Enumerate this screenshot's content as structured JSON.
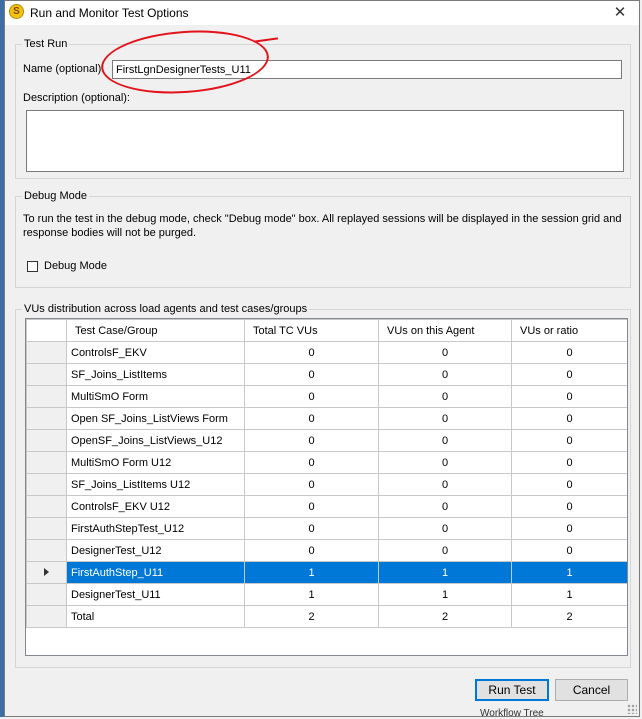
{
  "window": {
    "title": "Run and Monitor Test Options",
    "close_glyph": "✕",
    "icon_letter": "S"
  },
  "test_run": {
    "legend": "Test Run",
    "name_label": "Name (optional):",
    "name_value": "FirstLgnDesignerTests_U11",
    "description_label": "Description (optional):",
    "description_value": ""
  },
  "debug": {
    "legend": "Debug Mode",
    "info_line1": "To run the test in the debug mode, check \"Debug mode\" box. All replayed sessions will be displayed in the session grid and",
    "info_line2": "response bodies will not be purged.",
    "checkbox_label": "Debug Mode",
    "checked": false
  },
  "distribution": {
    "legend": "VUs distribution across load agents and test cases/groups",
    "columns": [
      "Test Case/Group",
      "Total TC VUs",
      "VUs on this Agent",
      "VUs or ratio"
    ],
    "rows": [
      {
        "name": "ControlsF_EKV",
        "total": "0",
        "agent": "0",
        "ratio": "0"
      },
      {
        "name": "SF_Joins_ListItems",
        "total": "0",
        "agent": "0",
        "ratio": "0"
      },
      {
        "name": "MultiSmO Form",
        "total": "0",
        "agent": "0",
        "ratio": "0"
      },
      {
        "name": "Open SF_Joins_ListViews Form",
        "total": "0",
        "agent": "0",
        "ratio": "0"
      },
      {
        "name": "OpenSF_Joins_ListViews_U12",
        "total": "0",
        "agent": "0",
        "ratio": "0"
      },
      {
        "name": "MultiSmO Form U12",
        "total": "0",
        "agent": "0",
        "ratio": "0"
      },
      {
        "name": "SF_Joins_ListItems  U12",
        "total": "0",
        "agent": "0",
        "ratio": "0"
      },
      {
        "name": "ControlsF_EKV  U12",
        "total": "0",
        "agent": "0",
        "ratio": "0"
      },
      {
        "name": "FirstAuthStepTest_U12",
        "total": "0",
        "agent": "0",
        "ratio": "0"
      },
      {
        "name": "DesignerTest_U12",
        "total": "0",
        "agent": "0",
        "ratio": "0"
      },
      {
        "name": "FirstAuthStep_U11",
        "total": "1",
        "agent": "1",
        "ratio": "1",
        "selected": true
      },
      {
        "name": "DesignerTest_U11",
        "total": "1",
        "agent": "1",
        "ratio": "1"
      },
      {
        "name": "Total",
        "total": "2",
        "agent": "2",
        "ratio": "2"
      }
    ]
  },
  "buttons": {
    "run": "Run Test",
    "cancel": "Cancel"
  },
  "background_peek": "Workflow Tree",
  "colors": {
    "selection": "#0078d7",
    "annotation": "#e3131b"
  }
}
